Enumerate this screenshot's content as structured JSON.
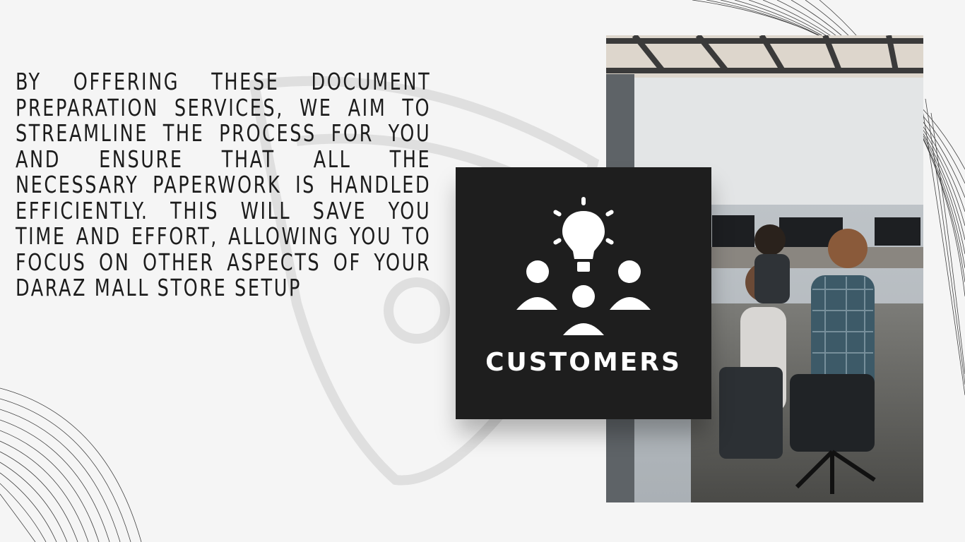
{
  "body_text": "BY OFFERING THESE DOCUMENT PREPARATION SERVICES, WE AIM TO STREAMLINE THE PROCESS FOR YOU AND ENSURE THAT ALL THE NECESSARY PAPERWORK IS HANDLED EFFICIENTLY. THIS WILL SAVE YOU TIME AND EFFORT, ALLOWING YOU TO FOCUS ON OTHER ASPECTS OF YOUR DARAZ MALL STORE SETUP",
  "card": {
    "label": "CUSTOMERS",
    "icon": "customers-idea-icon"
  },
  "photo": {
    "subject": "office-team-at-desks"
  },
  "colors": {
    "background": "#f5f5f5",
    "text": "#1c1c1c",
    "card": "#1e1e1e",
    "card_text": "#ffffff"
  }
}
